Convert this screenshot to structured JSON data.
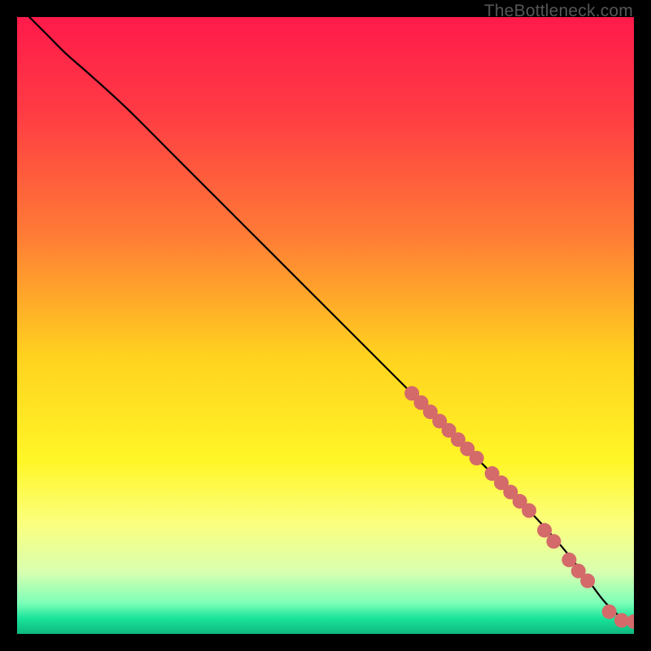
{
  "watermark": "TheBottleneck.com",
  "chart_data": {
    "type": "line",
    "title": "",
    "xlabel": "",
    "ylabel": "",
    "xlim": [
      0,
      100
    ],
    "ylim": [
      0,
      100
    ],
    "gradient_stops": [
      {
        "offset": 0.0,
        "color": "#ff1a4b"
      },
      {
        "offset": 0.15,
        "color": "#ff3a44"
      },
      {
        "offset": 0.35,
        "color": "#ff7a36"
      },
      {
        "offset": 0.55,
        "color": "#ffd21f"
      },
      {
        "offset": 0.72,
        "color": "#fff627"
      },
      {
        "offset": 0.82,
        "color": "#fcff7e"
      },
      {
        "offset": 0.9,
        "color": "#d8ffb0"
      },
      {
        "offset": 0.95,
        "color": "#7dffb8"
      },
      {
        "offset": 0.975,
        "color": "#19e39a"
      },
      {
        "offset": 1.0,
        "color": "#0fb97f"
      }
    ],
    "series": [
      {
        "name": "curve",
        "x": [
          2,
          5,
          8,
          12,
          18,
          25,
          32,
          40,
          48,
          56,
          64,
          71,
          77,
          83,
          88,
          92,
          95,
          97.5,
          99,
          100
        ],
        "y": [
          100,
          97,
          94,
          90.5,
          85,
          78,
          71,
          63,
          55,
          47,
          39,
          32,
          26,
          20,
          14.5,
          9.5,
          5.5,
          3,
          2,
          2
        ]
      }
    ],
    "markers": {
      "name": "highlight-segments",
      "color": "#d46a6a",
      "radius_px": 9,
      "points": [
        {
          "x": 64.0,
          "y": 39.0
        },
        {
          "x": 65.5,
          "y": 37.5
        },
        {
          "x": 67.0,
          "y": 36.0
        },
        {
          "x": 68.5,
          "y": 34.5
        },
        {
          "x": 70.0,
          "y": 33.0
        },
        {
          "x": 71.5,
          "y": 31.5
        },
        {
          "x": 73.0,
          "y": 30.0
        },
        {
          "x": 74.5,
          "y": 28.5
        },
        {
          "x": 77.0,
          "y": 26.0
        },
        {
          "x": 78.5,
          "y": 24.5
        },
        {
          "x": 80.0,
          "y": 23.0
        },
        {
          "x": 81.5,
          "y": 21.5
        },
        {
          "x": 83.0,
          "y": 20.0
        },
        {
          "x": 85.5,
          "y": 16.8
        },
        {
          "x": 87.0,
          "y": 15.0
        },
        {
          "x": 89.5,
          "y": 12.0
        },
        {
          "x": 91.0,
          "y": 10.2
        },
        {
          "x": 92.5,
          "y": 8.6
        },
        {
          "x": 96.0,
          "y": 3.6
        },
        {
          "x": 98.0,
          "y": 2.2
        },
        {
          "x": 100.0,
          "y": 2.0
        }
      ]
    }
  }
}
